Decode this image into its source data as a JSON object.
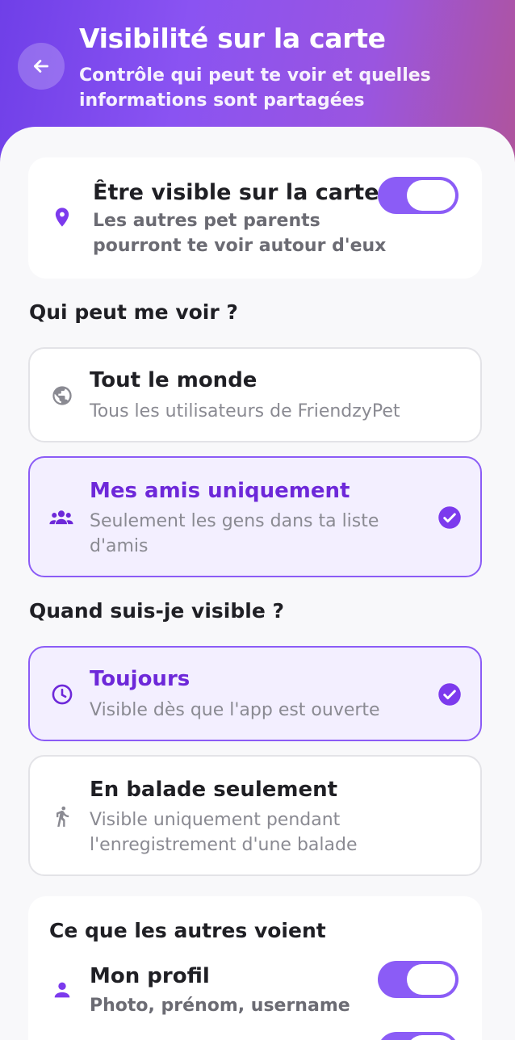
{
  "header": {
    "title": "Visibilité sur la carte",
    "subtitle": "Contrôle qui peut te voir et quelles informations sont partagées"
  },
  "visibility_card": {
    "title": "Être visible sur la carte",
    "subtitle": "Les autres pet parents pourront te voir autour d'eux",
    "toggle_on": true
  },
  "who_section": {
    "title": "Qui peut me voir ?",
    "options": [
      {
        "label": "Tout le monde",
        "sub": "Tous les utilisateurs de FriendzyPet",
        "selected": false,
        "icon": "globe-icon"
      },
      {
        "label": "Mes amis uniquement",
        "sub": "Seulement les gens dans ta liste d'amis",
        "selected": true,
        "icon": "group-icon"
      }
    ]
  },
  "when_section": {
    "title": "Quand suis-je visible ?",
    "options": [
      {
        "label": "Toujours",
        "sub": "Visible dès que l'app est ouverte",
        "selected": true,
        "icon": "clock-icon"
      },
      {
        "label": "En balade seulement",
        "sub": "Visible uniquement pendant l'enregistrement d'une balade",
        "selected": false,
        "icon": "walk-icon"
      }
    ]
  },
  "shared_section": {
    "title": "Ce que les autres voient",
    "items": [
      {
        "label": "Mon profil",
        "sub": "Photo, prénom, username",
        "toggle_on": true,
        "icon": "person-icon"
      }
    ]
  },
  "colors": {
    "accent": "#8b5cf6",
    "accent_dark": "#6d28d9",
    "header_start": "#6f3fe8",
    "header_end": "#b0549a"
  }
}
